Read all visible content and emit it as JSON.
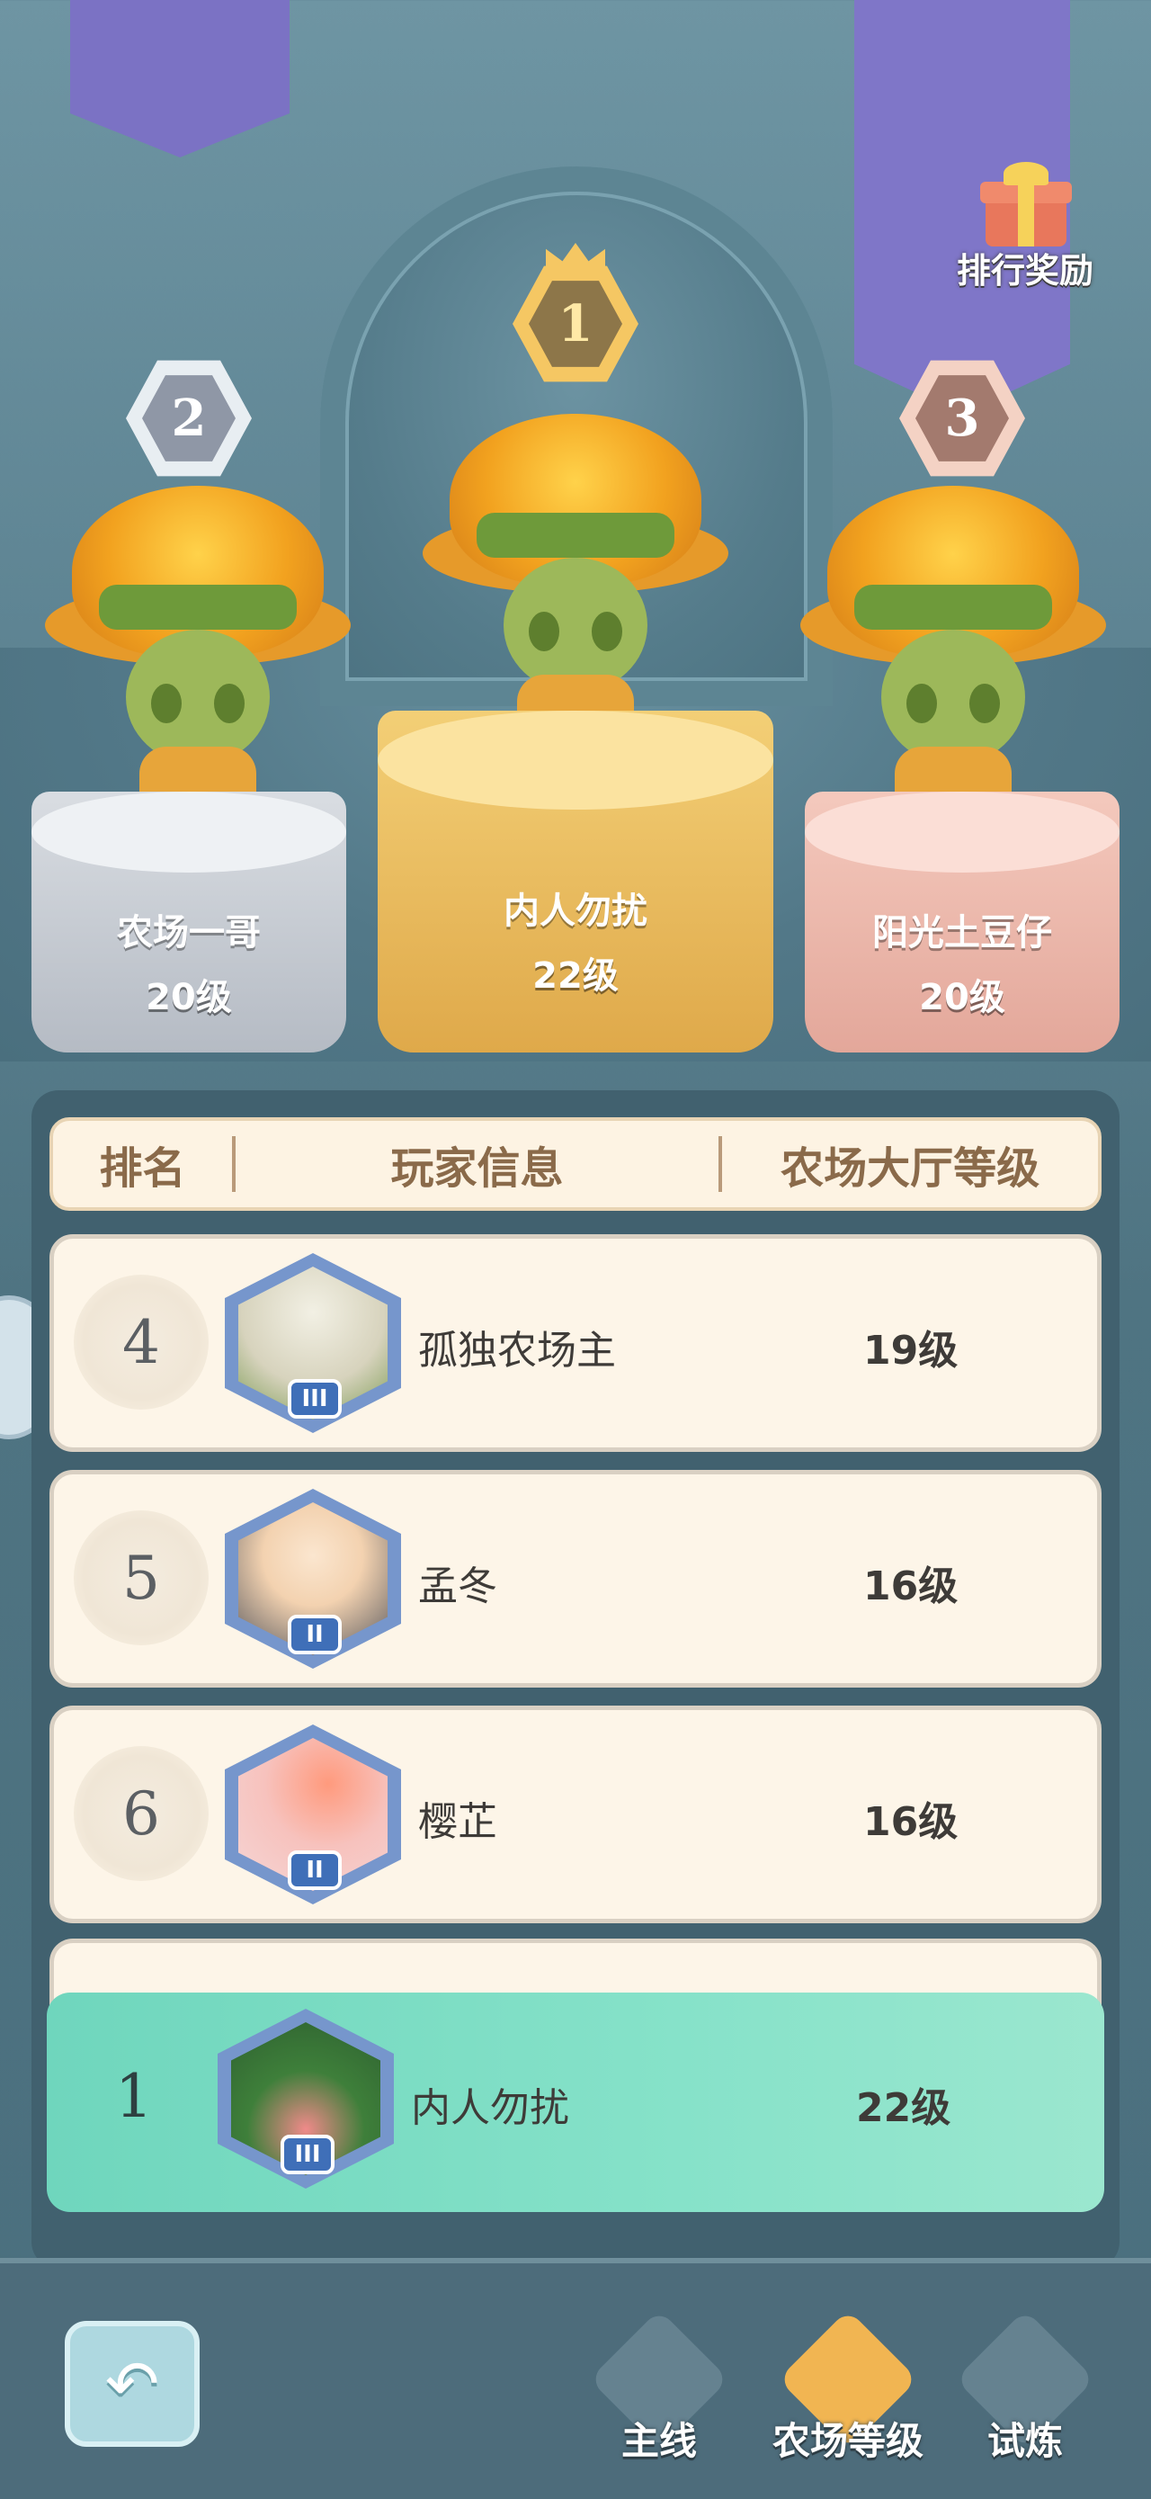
{
  "podium": {
    "first": {
      "rank": "1",
      "name": "内人勿扰",
      "level": "22级"
    },
    "second": {
      "rank": "2",
      "name": "农场一哥",
      "level": "20级"
    },
    "third": {
      "rank": "3",
      "name": "阳光土豆仔",
      "level": "20级"
    }
  },
  "reward": {
    "label": "排行奖励"
  },
  "table": {
    "headers": [
      "排名",
      "玩家信息",
      "农场大厅等级"
    ],
    "rows": [
      {
        "rank": "4",
        "name": "孤独农场主",
        "level": "19级",
        "tier": "III"
      },
      {
        "rank": "5",
        "name": "孟冬",
        "level": "16级",
        "tier": "II"
      },
      {
        "rank": "6",
        "name": "樱芷",
        "level": "16级",
        "tier": "II"
      }
    ],
    "mine": {
      "rank": "1",
      "name": "内人勿扰",
      "level": "22级",
      "tier": "III"
    }
  },
  "tabs": [
    {
      "label": "主线",
      "active": false
    },
    {
      "label": "农场等级",
      "active": true
    },
    {
      "label": "试炼",
      "active": false
    }
  ],
  "colors": {
    "accent_purple": "#7b72c4",
    "gold": "#f5c763",
    "mint_highlight": "#86e2c9",
    "panel": "#41616f"
  }
}
